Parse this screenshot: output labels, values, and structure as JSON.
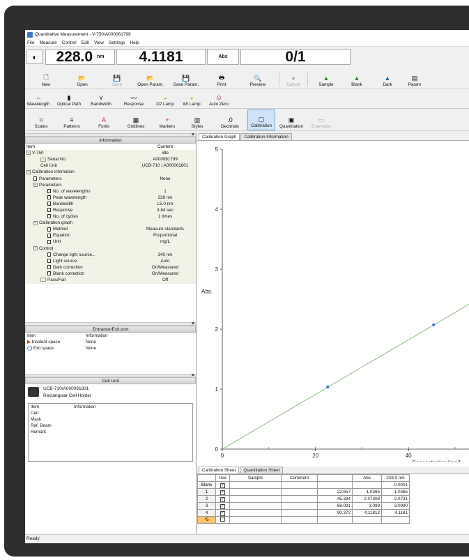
{
  "window": {
    "title": "Quantitative Measurement - V-750/A000061799"
  },
  "menu": [
    "File",
    "Measure",
    "Control",
    "Edit",
    "View",
    "Settings",
    "Help"
  ],
  "readout": {
    "wavelength": "228.0",
    "wavelength_unit": "nm",
    "abs_value": "4.1181",
    "abs_unit": "Abs",
    "counter": "0/1"
  },
  "toolbar1": [
    {
      "label": "New",
      "icon": "new-icon",
      "state": "normal"
    },
    {
      "label": "Open",
      "icon": "open-icon",
      "state": "normal"
    },
    {
      "label": "Save",
      "icon": "save-icon",
      "state": "disabled"
    },
    {
      "label": "Open Param.",
      "icon": "open-param-icon",
      "state": "normal"
    },
    {
      "label": "Save Param.",
      "icon": "save-param-icon",
      "state": "normal"
    },
    {
      "label": "Print",
      "icon": "print-icon",
      "state": "normal"
    },
    {
      "label": "Preview",
      "icon": "preview-icon",
      "state": "normal"
    },
    {
      "label": "Cancel",
      "icon": "cancel-icon",
      "state": "disabled"
    },
    {
      "label": "Sample",
      "icon": "sample-icon",
      "state": "normal"
    },
    {
      "label": "Blank",
      "icon": "blank-icon",
      "state": "normal"
    },
    {
      "label": "Dark",
      "icon": "dark-icon",
      "state": "normal"
    },
    {
      "label": "Param",
      "icon": "param-icon",
      "state": "normal"
    }
  ],
  "toolbar2": [
    {
      "label": "Wavelength",
      "icon": "wavelength-icon"
    },
    {
      "label": "Optical Path",
      "icon": "optical-path-icon"
    },
    {
      "label": "Bandwidth",
      "icon": "bandwidth-icon"
    },
    {
      "label": "Response",
      "icon": "response-icon"
    },
    {
      "label": "D2 Lamp",
      "icon": "d2-lamp-icon"
    },
    {
      "label": "WI Lamp",
      "icon": "wi-lamp-icon"
    },
    {
      "label": "Auto Zero",
      "icon": "auto-zero-icon"
    }
  ],
  "toolbar3": [
    {
      "label": "Scales",
      "icon": "scales-icon",
      "state": "normal"
    },
    {
      "label": "Patterns",
      "icon": "patterns-icon",
      "state": "normal"
    },
    {
      "label": "Fonts",
      "icon": "fonts-icon",
      "state": "normal"
    },
    {
      "label": "Gridlines",
      "icon": "gridlines-icon",
      "state": "normal"
    },
    {
      "label": "Markers",
      "icon": "markers-icon",
      "state": "normal"
    },
    {
      "label": "Styles",
      "icon": "styles-icon",
      "state": "normal"
    },
    {
      "label": "Decimals",
      "icon": "decimals-icon",
      "state": "normal"
    },
    {
      "label": "Calibration",
      "icon": "calibration-icon",
      "state": "active"
    },
    {
      "label": "Quantitation",
      "icon": "quantitation-icon",
      "state": "normal"
    },
    {
      "label": "Extension",
      "icon": "extension-icon",
      "state": "disabled"
    }
  ],
  "info_panel": {
    "title": "Information",
    "col_item": "Item",
    "col_content": "Content",
    "rows": [
      {
        "indent": 0,
        "icon": "tree",
        "label": "V-750",
        "value": "idle"
      },
      {
        "indent": 2,
        "icon": "grid",
        "label": "Serial No.",
        "value": "A000061799"
      },
      {
        "indent": 2,
        "icon": "none",
        "label": "Cell Unit",
        "value": "UCB-710 / A000061801"
      },
      {
        "indent": 0,
        "icon": "tree",
        "label": "Calibration infomation",
        "value": ""
      },
      {
        "indent": 1,
        "icon": "doc",
        "label": "Parameters",
        "value": "None"
      },
      {
        "indent": 1,
        "icon": "tree",
        "label": "Parameters",
        "value": ""
      },
      {
        "indent": 3,
        "icon": "doc",
        "label": "No. of wavelengths",
        "value": "1"
      },
      {
        "indent": 3,
        "icon": "doc",
        "label": "Peak wavelength",
        "value": "228 nm"
      },
      {
        "indent": 3,
        "icon": "doc",
        "label": "Bandwidth",
        "value": "L5.0 nm"
      },
      {
        "indent": 3,
        "icon": "doc",
        "label": "Response",
        "value": "3.84 sec"
      },
      {
        "indent": 3,
        "icon": "doc",
        "label": "No. of cycles",
        "value": "1 times"
      },
      {
        "indent": 1,
        "icon": "tree",
        "label": "Calibration graph",
        "value": ""
      },
      {
        "indent": 3,
        "icon": "doc",
        "label": "Method",
        "value": "Measure standards"
      },
      {
        "indent": 3,
        "icon": "doc",
        "label": "Equation",
        "value": "Proportional"
      },
      {
        "indent": 3,
        "icon": "doc",
        "label": "Unit",
        "value": "mg/L"
      },
      {
        "indent": 1,
        "icon": "tree",
        "label": "Control",
        "value": ""
      },
      {
        "indent": 3,
        "icon": "doc",
        "label": "Change light source...",
        "value": "340 nm"
      },
      {
        "indent": 3,
        "icon": "doc",
        "label": "Light source",
        "value": "Auto"
      },
      {
        "indent": 3,
        "icon": "doc",
        "label": "Dark correction",
        "value": "On/Measured"
      },
      {
        "indent": 3,
        "icon": "doc",
        "label": "Blank correction",
        "value": "On/Measured"
      },
      {
        "indent": 2,
        "icon": "fold",
        "label": "Pass/Fail",
        "value": "Off"
      }
    ]
  },
  "entrance_panel": {
    "title": "Entrance/Exit port",
    "col_item": "Item",
    "col_info": "Information",
    "rows": [
      {
        "label": "Incident space",
        "value": "None",
        "color": "#c0392b"
      },
      {
        "label": "Exit space",
        "value": "None",
        "color": "#2c6fbf"
      }
    ]
  },
  "cellunit_panel": {
    "title": "Cell Unit",
    "model": "UCB-710/A000061801",
    "holder": "Rectangular Cell Holder",
    "col_item": "Item",
    "col_info": "Information",
    "rows": [
      "Cell",
      "Mask",
      "Ref. Beam",
      "Remark"
    ]
  },
  "graph_tabs": [
    "Calibration Graph",
    "Calibration Information"
  ],
  "sheet_tabs": [
    "Calibration Sheet",
    "Quantitation Sheet"
  ],
  "chart_data": {
    "type": "scatter",
    "xlabel": "Concentration [mg/L",
    "ylabel": "Abs.",
    "x_ticks": [
      0,
      20,
      40
    ],
    "y_ticks": [
      0,
      1,
      2,
      3,
      4,
      5
    ],
    "ylim": [
      0,
      5
    ],
    "x_visible_max": 53,
    "line": {
      "slope": 0.04557,
      "color": "#7cb46f"
    },
    "points": [
      {
        "x": 22.657,
        "y": 1.0365
      },
      {
        "x": 45.394,
        "y": 2.07308
      }
    ],
    "point_color": "#2e6fc2"
  },
  "sheet": {
    "headers": [
      "",
      "Use",
      "Sample",
      "Comment",
      "Conc. [mg/L]",
      "Abs",
      "228.0 nm"
    ],
    "rows": [
      {
        "id": "Blank",
        "use": true,
        "sample": "",
        "comment": "",
        "conc": "",
        "abs": "",
        "nm": "-0.0001"
      },
      {
        "id": "1",
        "use": true,
        "sample": "",
        "comment": "",
        "conc": "22.657",
        "abs": "1.0365",
        "nm": "1.0365"
      },
      {
        "id": "2",
        "use": true,
        "sample": "",
        "comment": "",
        "conc": "45.394",
        "abs": "2.07308",
        "nm": "2.0731"
      },
      {
        "id": "3",
        "use": true,
        "sample": "",
        "comment": "",
        "conc": "68.091",
        "abs": "3.099",
        "nm": "3.0990"
      },
      {
        "id": "4",
        "use": true,
        "sample": "",
        "comment": "",
        "conc": "90.372",
        "abs": "4.11812",
        "nm": "4.1181"
      },
      {
        "id": "*5",
        "use": false,
        "sample": "",
        "comment": "",
        "conc": "",
        "abs": "",
        "nm": ""
      }
    ]
  },
  "status": "Ready"
}
